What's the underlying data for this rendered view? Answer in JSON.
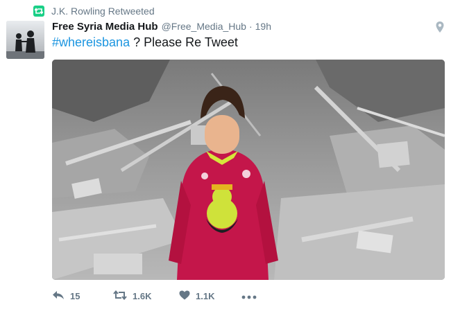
{
  "context": {
    "label": "J.K. Rowling Retweeted",
    "icon": "retweet-icon",
    "color": "#19cf86"
  },
  "tweet": {
    "fullname": "Free Syria Media Hub",
    "screen_name": "@Free_Media_Hub",
    "separator": "·",
    "timestamp": "19h",
    "hashtag": "#whereisbana",
    "text": " ? Please Re Tweet"
  },
  "actions": {
    "reply_count": "15",
    "retweet_count": "1.6K",
    "like_count": "1.1K"
  },
  "colors": {
    "link": "#1b95e0",
    "secondary_text": "#657786",
    "retweet_green": "#19cf86"
  }
}
